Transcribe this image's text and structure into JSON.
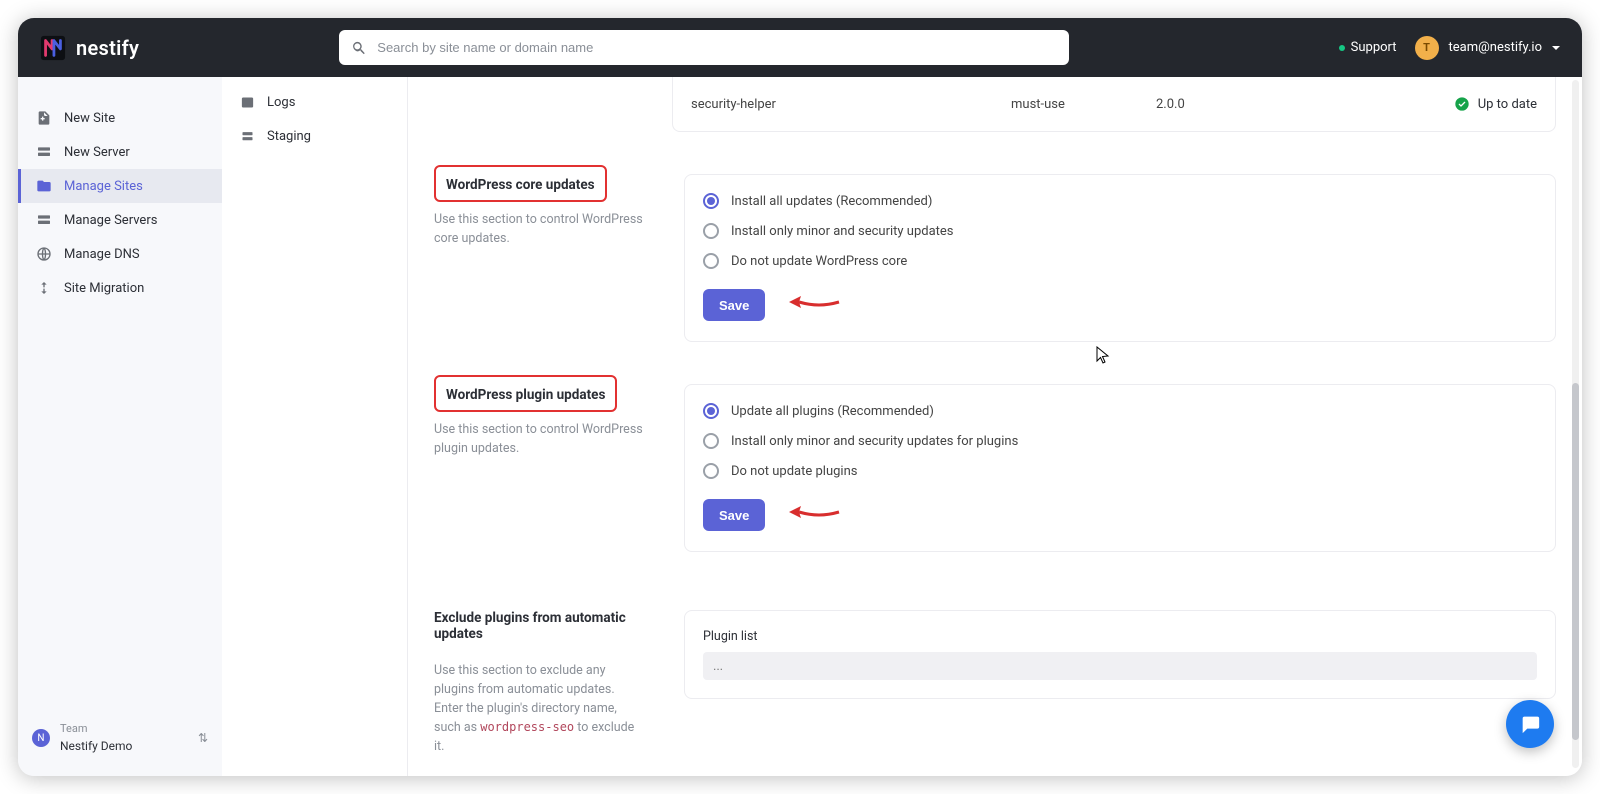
{
  "brand": {
    "name": "nestify"
  },
  "search": {
    "placeholder": "Search by site name or domain name"
  },
  "header": {
    "support_label": "Support",
    "user_initial": "T",
    "user_email": "team@nestify.io"
  },
  "sidebar1": {
    "items": [
      {
        "id": "new-site",
        "label": "New Site"
      },
      {
        "id": "new-server",
        "label": "New Server"
      },
      {
        "id": "manage-sites",
        "label": "Manage Sites",
        "active": true
      },
      {
        "id": "manage-servers",
        "label": "Manage Servers"
      },
      {
        "id": "manage-dns",
        "label": "Manage DNS"
      },
      {
        "id": "site-migration",
        "label": "Site Migration"
      }
    ],
    "team": {
      "label": "Team",
      "name": "Nestify Demo",
      "initial": "N"
    }
  },
  "sidebar2": {
    "items": [
      {
        "id": "logs",
        "label": "Logs"
      },
      {
        "id": "staging",
        "label": "Staging"
      }
    ]
  },
  "plugin_row": {
    "name": "security-helper",
    "type": "must-use",
    "version": "2.0.0",
    "status": "Up to date"
  },
  "core_updates": {
    "title": "WordPress core updates",
    "desc": "Use this section to control WordPress core updates.",
    "options": [
      "Install all updates (Recommended)",
      "Install only minor and security updates",
      "Do not update WordPress core"
    ],
    "save_label": "Save"
  },
  "plugin_updates": {
    "title": "WordPress plugin updates",
    "desc": "Use this section to control WordPress plugin updates.",
    "options": [
      "Update all plugins (Recommended)",
      "Install only minor and security updates for plugins",
      "Do not update plugins"
    ],
    "save_label": "Save"
  },
  "exclude": {
    "title": "Exclude plugins from automatic updates",
    "desc_pre": "Use this section to exclude any plugins from automatic updates. Enter the plugin's directory name, such as ",
    "code": "wordpress-seo",
    "desc_post": " to exclude it.",
    "field_label": "Plugin list",
    "placeholder": "..."
  }
}
